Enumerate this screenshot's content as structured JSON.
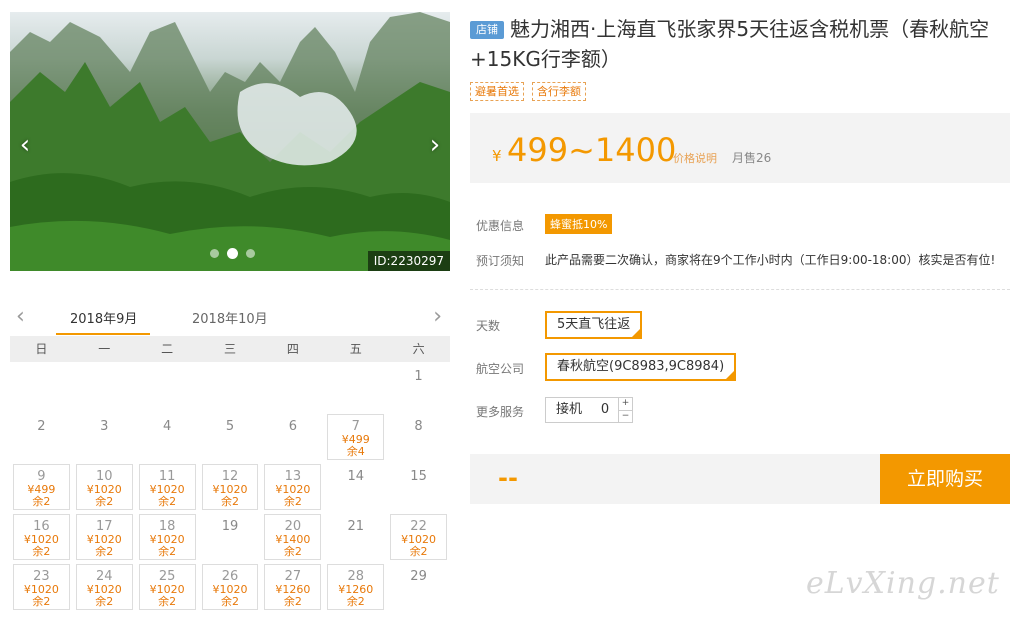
{
  "gallery": {
    "id_tag": "ID:2230297",
    "prev": "‹",
    "next": "›",
    "slide_count": 3,
    "active_slide": 1
  },
  "product": {
    "shop_badge": "店铺",
    "title": "魅力湘西·上海直飞张家界5天往返含税机票（春秋航空+15KG行李额）",
    "tags": [
      "避暑首选",
      "含行李额"
    ]
  },
  "price": {
    "currency": "¥",
    "range": "499~1400",
    "note": "价格说明",
    "sold": "月售26"
  },
  "promo": {
    "label": "优惠信息",
    "badge": "蜂蜜抵10%"
  },
  "notice": {
    "label": "预订须知",
    "text": "此产品需要二次确认，商家将在9个工作小时内（工作日9:00-18:00）核实是否有位!"
  },
  "options": {
    "days_label": "天数",
    "days_value": "5天直飞往返",
    "airline_label": "航空公司",
    "airline_value": "春秋航空(9C8983,9C8984)",
    "service_label": "更多服务",
    "pickup_label": "接机",
    "pickup_qty": "0",
    "plus": "+",
    "minus": "−"
  },
  "buy": {
    "total": "--",
    "button": "立即购买"
  },
  "calendar": {
    "prev": "‹",
    "next": "›",
    "months": [
      "2018年9月",
      "2018年10月"
    ],
    "weekdays": [
      "日",
      "一",
      "二",
      "三",
      "四",
      "五",
      "六"
    ],
    "days": [
      {
        "d": "1"
      },
      {
        "d": "2"
      },
      {
        "d": "3"
      },
      {
        "d": "4"
      },
      {
        "d": "5"
      },
      {
        "d": "6"
      },
      {
        "d": "7",
        "p": "¥499",
        "r": "余4"
      },
      {
        "d": "8"
      },
      {
        "d": "9",
        "p": "¥499",
        "r": "余2"
      },
      {
        "d": "10",
        "p": "¥1020",
        "r": "余2"
      },
      {
        "d": "11",
        "p": "¥1020",
        "r": "余2"
      },
      {
        "d": "12",
        "p": "¥1020",
        "r": "余2"
      },
      {
        "d": "13",
        "p": "¥1020",
        "r": "余2"
      },
      {
        "d": "14"
      },
      {
        "d": "15"
      },
      {
        "d": "16",
        "p": "¥1020",
        "r": "余2"
      },
      {
        "d": "17",
        "p": "¥1020",
        "r": "余2"
      },
      {
        "d": "18",
        "p": "¥1020",
        "r": "余2"
      },
      {
        "d": "19"
      },
      {
        "d": "20",
        "p": "¥1400",
        "r": "余2"
      },
      {
        "d": "21"
      },
      {
        "d": "22",
        "p": "¥1020",
        "r": "余2"
      },
      {
        "d": "23",
        "p": "¥1020",
        "r": "余2"
      },
      {
        "d": "24",
        "p": "¥1020",
        "r": "余2"
      },
      {
        "d": "25",
        "p": "¥1020",
        "r": "余2"
      },
      {
        "d": "26",
        "p": "¥1020",
        "r": "余2"
      },
      {
        "d": "27",
        "p": "¥1260",
        "r": "余2"
      },
      {
        "d": "28",
        "p": "¥1260",
        "r": "余2"
      },
      {
        "d": "29"
      }
    ],
    "first_weekday": 6
  },
  "watermark": "eLvXing.net",
  "colors": {
    "accent": "#f39800",
    "shop_badge": "#5b9bd5"
  }
}
